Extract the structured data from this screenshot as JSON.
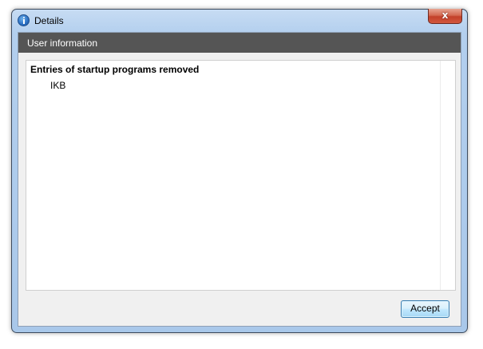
{
  "window": {
    "title": "Details",
    "icon": "info-icon",
    "close_label": "x"
  },
  "header": {
    "title": "User information",
    "background": "#555555"
  },
  "content": {
    "section_heading": "Entries of startup programs removed",
    "entries": [
      "IKB"
    ]
  },
  "footer": {
    "accept_label": "Accept"
  },
  "colors": {
    "accent": "#3c7fb1",
    "close_red": "#c3402a"
  }
}
